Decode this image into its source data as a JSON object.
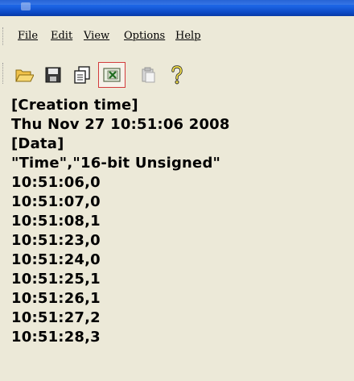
{
  "menu": {
    "file": "File",
    "edit": "Edit",
    "view": "View",
    "options": "Options",
    "help": "Help"
  },
  "toolbar": {
    "buttons": [
      "open-folder-icon",
      "save-icon",
      "copy-icon",
      "excel-export-icon",
      "paste-icon",
      "help-icon"
    ],
    "highlight_color": "#d23c3c"
  },
  "content": {
    "lines": [
      "[Creation time]",
      "Thu Nov 27 10:51:06 2008",
      "[Data]",
      "\"Time\",\"16-bit Unsigned\"",
      "10:51:06,0",
      "10:51:07,0",
      "10:51:08,1",
      "10:51:23,0",
      "10:51:24,0",
      "10:51:25,1",
      "10:51:26,1",
      "10:51:27,2",
      "10:51:28,3"
    ]
  },
  "colors": {
    "window_bg": "#ece9d8",
    "titlebar": "#0b47c2"
  }
}
